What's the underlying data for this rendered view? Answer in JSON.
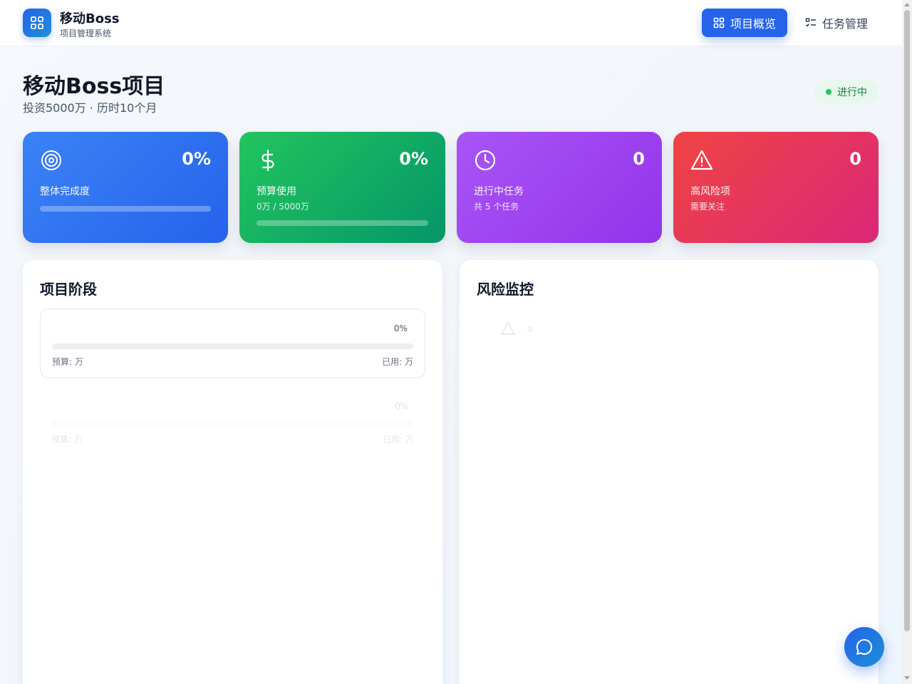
{
  "app": {
    "name": "移动Boss",
    "subtitle": "项目管理系统"
  },
  "nav": {
    "items": [
      {
        "label": "项目概览",
        "icon": "dashboard-icon",
        "active": true
      },
      {
        "label": "任务管理",
        "icon": "task-list-icon",
        "active": false
      }
    ]
  },
  "project": {
    "title": "移动Boss项目",
    "meta": "投资5000万 · 历时10个月",
    "status": "进行中"
  },
  "stats": [
    {
      "icon": "target-icon",
      "value": "0%",
      "label": "整体完成度",
      "note": "",
      "progress": 0
    },
    {
      "icon": "dollar-icon",
      "value": "0%",
      "label": "预算使用",
      "note": "0万 / 5000万",
      "progress": 0
    },
    {
      "icon": "clock-icon",
      "value": "0",
      "label": "进行中任务",
      "note": "共 5 个任务"
    },
    {
      "icon": "alert-triangle-icon",
      "value": "0",
      "label": "高风险项",
      "note": "需要关注"
    }
  ],
  "phases": {
    "title": "项目阶段",
    "items": [
      {
        "name": "",
        "percent": "0%",
        "progress": 0,
        "budget": "预算: 万",
        "used": "已用: 万"
      },
      {
        "name": "",
        "percent": "0%",
        "progress": 0,
        "budget": "预算: 万",
        "used": "已用: 万"
      }
    ]
  },
  "risks": {
    "title": "风险监控",
    "items": [
      {
        "icon": "alert-triangle-icon",
        "level": "≥"
      }
    ]
  },
  "colors": {
    "primary": "#2563eb",
    "card_blue": "#3b82f6",
    "card_green": "#16a34a",
    "card_purple": "#a855f7",
    "card_red": "#ef4444",
    "status_green": "#22c55e"
  }
}
